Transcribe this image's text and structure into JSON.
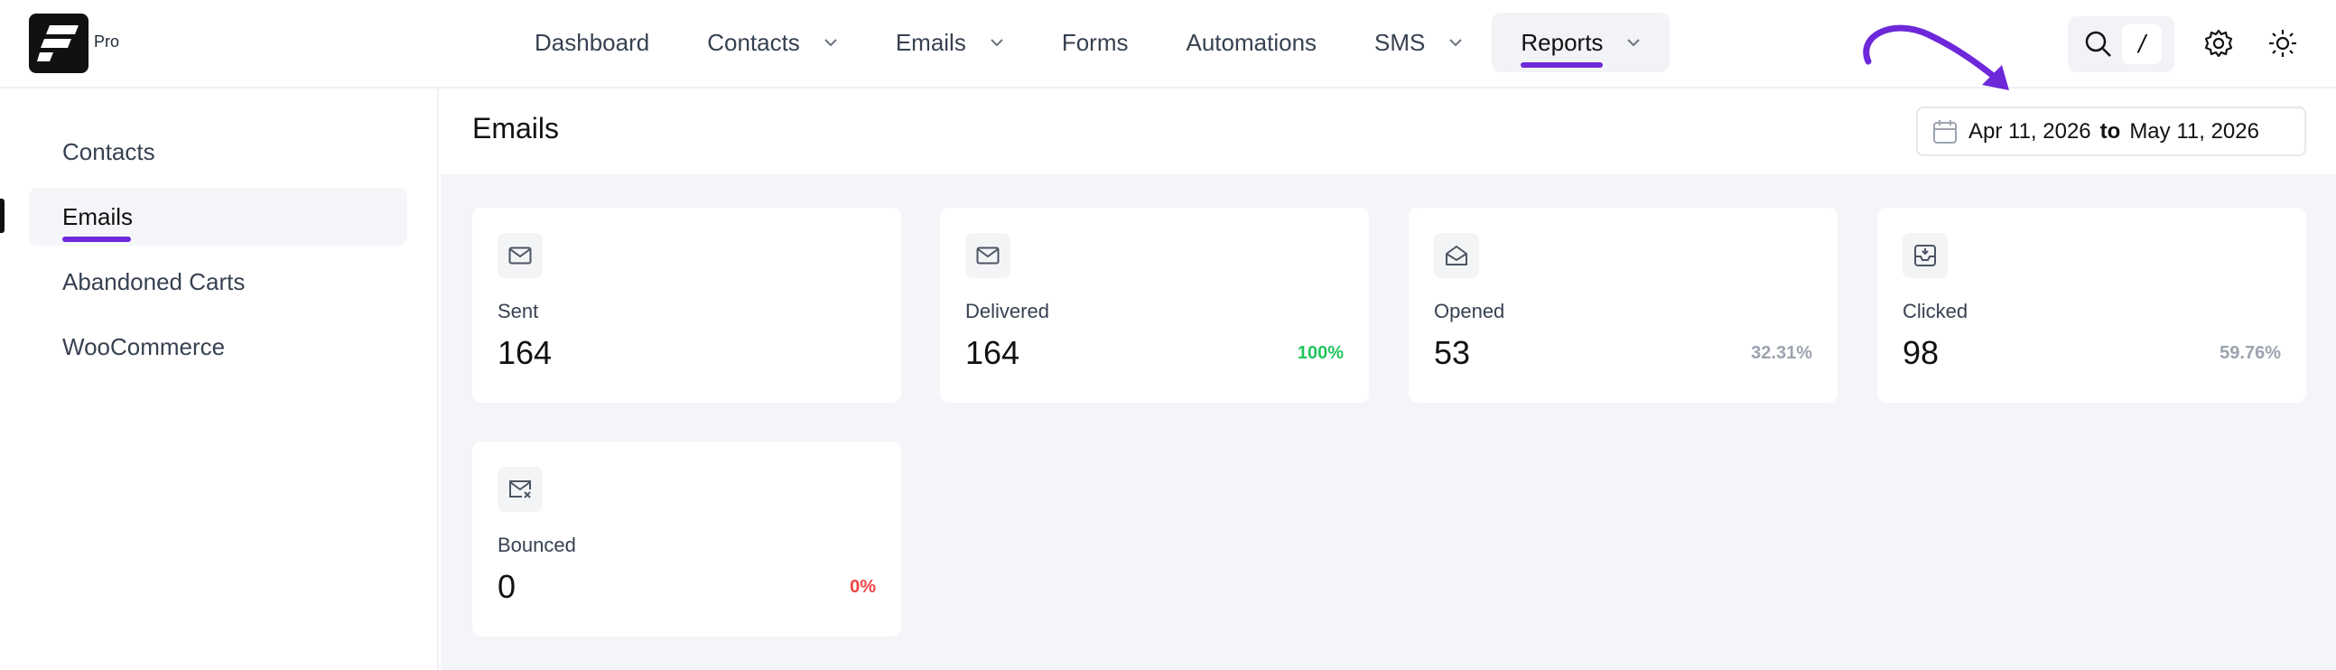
{
  "brand": {
    "badge": "Pro"
  },
  "nav": [
    {
      "label": "Dashboard",
      "has_dropdown": false,
      "active": false
    },
    {
      "label": "Contacts",
      "has_dropdown": true,
      "active": false
    },
    {
      "label": "Emails",
      "has_dropdown": true,
      "active": false
    },
    {
      "label": "Forms",
      "has_dropdown": false,
      "active": false
    },
    {
      "label": "Automations",
      "has_dropdown": false,
      "active": false
    },
    {
      "label": "SMS",
      "has_dropdown": true,
      "active": false
    },
    {
      "label": "Reports",
      "has_dropdown": true,
      "active": true
    }
  ],
  "tools": {
    "search_icon": "search-icon",
    "shortcut_key": "/",
    "settings_icon": "gear-icon",
    "theme_icon": "sun-icon"
  },
  "sidebar": {
    "items": [
      {
        "label": "Contacts",
        "active": false
      },
      {
        "label": "Emails",
        "active": true
      },
      {
        "label": "Abandoned Carts",
        "active": false
      },
      {
        "label": "WooCommerce",
        "active": false
      }
    ]
  },
  "main": {
    "title": "Emails",
    "date_range": {
      "from": "Apr 11, 2026",
      "separator": "to",
      "to": "May 11, 2026"
    }
  },
  "stats": [
    {
      "label": "Sent",
      "value": "164",
      "percent": "",
      "icon": "mail-icon"
    },
    {
      "label": "Delivered",
      "value": "164",
      "percent": "100%",
      "percent_color": "#22c55e",
      "icon": "mail-icon"
    },
    {
      "label": "Opened",
      "value": "53",
      "percent": "32.31%",
      "percent_color": "#9ca3af",
      "icon": "mail-open-icon"
    },
    {
      "label": "Clicked",
      "value": "98",
      "percent": "59.76%",
      "percent_color": "#9ca3af",
      "icon": "inbox-icon"
    },
    {
      "label": "Bounced",
      "value": "0",
      "percent": "0%",
      "percent_color": "#ef4444",
      "icon": "mail-x-icon"
    }
  ],
  "colors": {
    "accent": "#6d28d9",
    "background": "#f4f5f8"
  }
}
